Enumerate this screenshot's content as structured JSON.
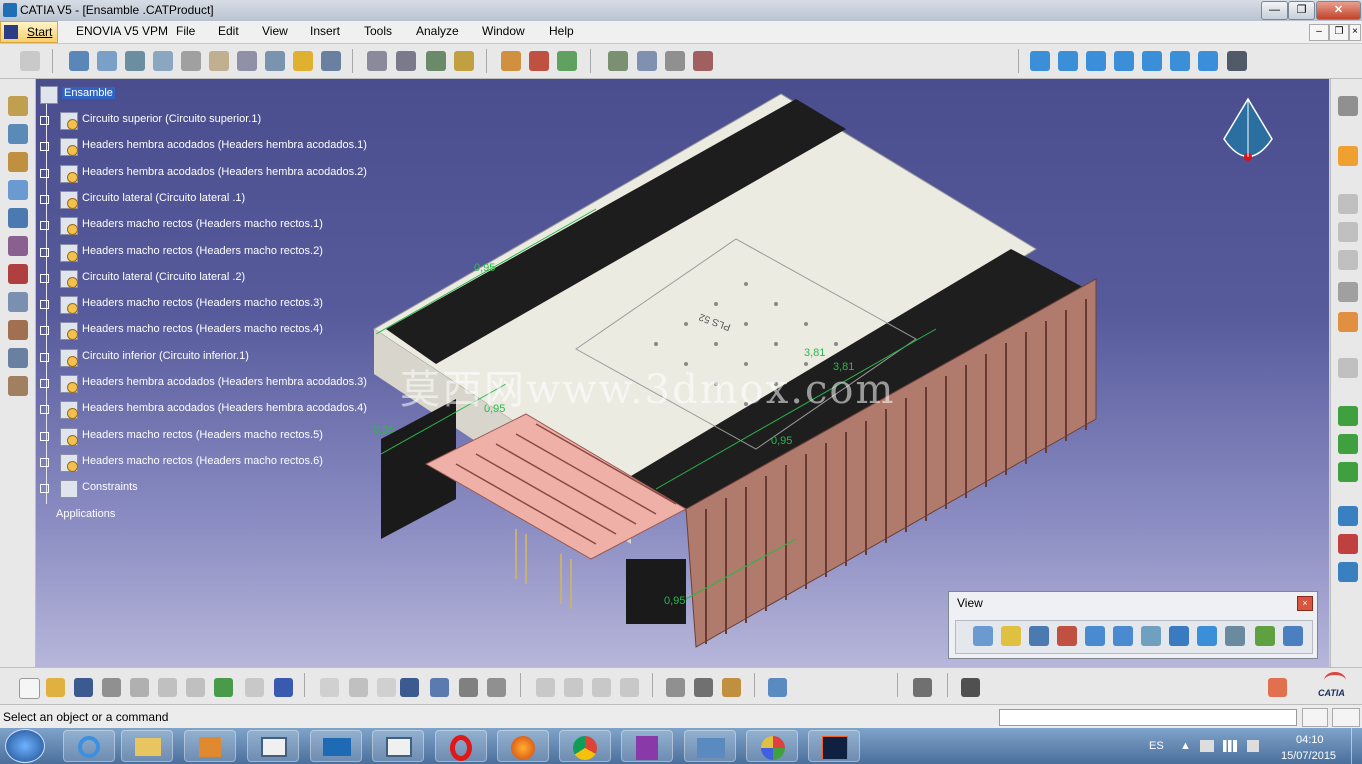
{
  "window": {
    "title": "CATIA V5 - [Ensamble .CATProduct]",
    "controls": [
      "—",
      "❐",
      "✕"
    ]
  },
  "menubar": {
    "start": "Start",
    "items": [
      "ENOVIA V5 VPM",
      "File",
      "Edit",
      "View",
      "Insert",
      "Tools",
      "Analyze",
      "Window",
      "Help"
    ]
  },
  "tree": {
    "root": "Ensamble",
    "items": [
      "Circuito superior (Circuito superior.1)",
      "Headers hembra acodados (Headers hembra acodados.1)",
      "Headers hembra acodados (Headers hembra acodados.2)",
      "Circuito lateral  (Circuito lateral .1)",
      "Headers macho rectos (Headers macho rectos.1)",
      "Headers macho rectos (Headers macho rectos.2)",
      "Circuito lateral  (Circuito lateral .2)",
      "Headers macho rectos (Headers macho rectos.3)",
      "Headers macho rectos (Headers macho rectos.4)",
      "Circuito inferior (Circuito inferior.1)",
      "Headers hembra acodados (Headers hembra acodados.3)",
      "Headers hembra acodados (Headers hembra acodados.4)",
      "Headers macho rectos (Headers macho rectos.5)",
      "Headers macho rectos (Headers macho rectos.6)"
    ],
    "constraints": "Constraints",
    "applications": "Applications"
  },
  "model": {
    "dimensions": [
      "0,95",
      "3,81",
      "3,81",
      "0,95",
      "0,95",
      "0,95",
      "0,95"
    ],
    "board_text": "PLS 52",
    "colors": {
      "pcb": "#f0eee4",
      "connector": "#1c1c1c",
      "pink_pads": "#efb0a8",
      "constraint": "#2ab84a",
      "side_board": "#b07a6c"
    }
  },
  "watermark": "莫西网www.3dmox.com",
  "view_panel": {
    "title": "View",
    "icons": [
      "fly-mode-icon",
      "fit-all-icon",
      "pan-icon",
      "rotate-icon",
      "zoom-in-icon",
      "zoom-out-icon",
      "normal-view-icon",
      "multi-view-icon",
      "quick-view-icon",
      "shading-icon",
      "hide-show-icon",
      "swap-space-icon"
    ]
  },
  "status": {
    "message": "Select an object or a command"
  },
  "taskbar": {
    "apps": [
      "ie-icon",
      "explorer-icon",
      "media-icon",
      "catia-doc-icon",
      "catia-icon",
      "notepad-icon",
      "opera-icon",
      "firefox-icon",
      "chrome-icon",
      "onenote-icon",
      "photo-icon",
      "paint-icon",
      "app-icon"
    ],
    "language": "ES",
    "time": "04:10",
    "date": "15/07/2015"
  },
  "brand": {
    "catia_logo": "CATIA"
  }
}
